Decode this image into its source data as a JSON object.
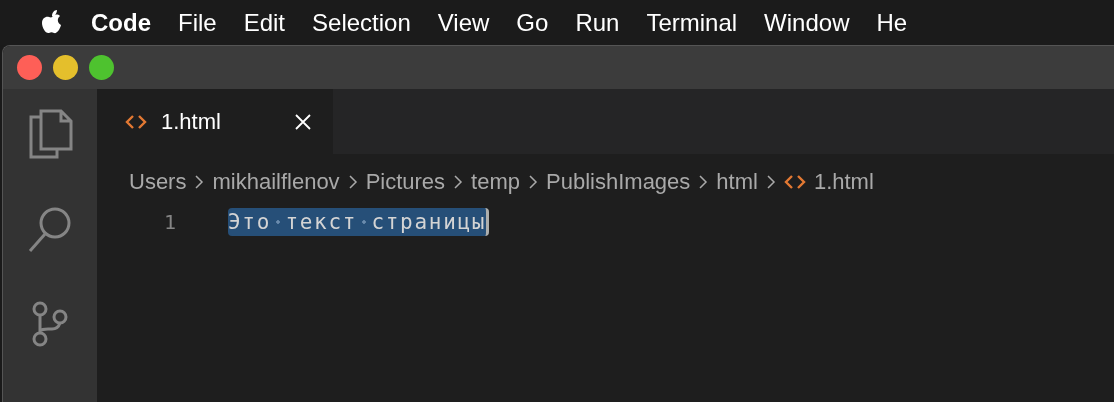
{
  "menu_bar": {
    "items": [
      {
        "label": "Code",
        "kind": "app"
      },
      {
        "label": "File",
        "kind": "menu"
      },
      {
        "label": "Edit",
        "kind": "menu"
      },
      {
        "label": "Selection",
        "kind": "menu"
      },
      {
        "label": "View",
        "kind": "menu"
      },
      {
        "label": "Go",
        "kind": "menu"
      },
      {
        "label": "Run",
        "kind": "menu"
      },
      {
        "label": "Terminal",
        "kind": "menu"
      },
      {
        "label": "Window",
        "kind": "menu"
      },
      {
        "label": "He",
        "kind": "menu"
      }
    ]
  },
  "activity_bar": {
    "items": [
      {
        "kind": "explorer"
      },
      {
        "kind": "search"
      },
      {
        "kind": "source-control"
      }
    ]
  },
  "tabs": [
    {
      "label": "1.html",
      "selected": true
    }
  ],
  "breadcrumbs": [
    "Users",
    "mikhailflenov",
    "Pictures",
    "temp",
    "PublishImages",
    "html",
    "1.html"
  ],
  "editor": {
    "lines": [
      {
        "number": "1",
        "text": "Это текст страницы",
        "selected": true
      }
    ]
  }
}
